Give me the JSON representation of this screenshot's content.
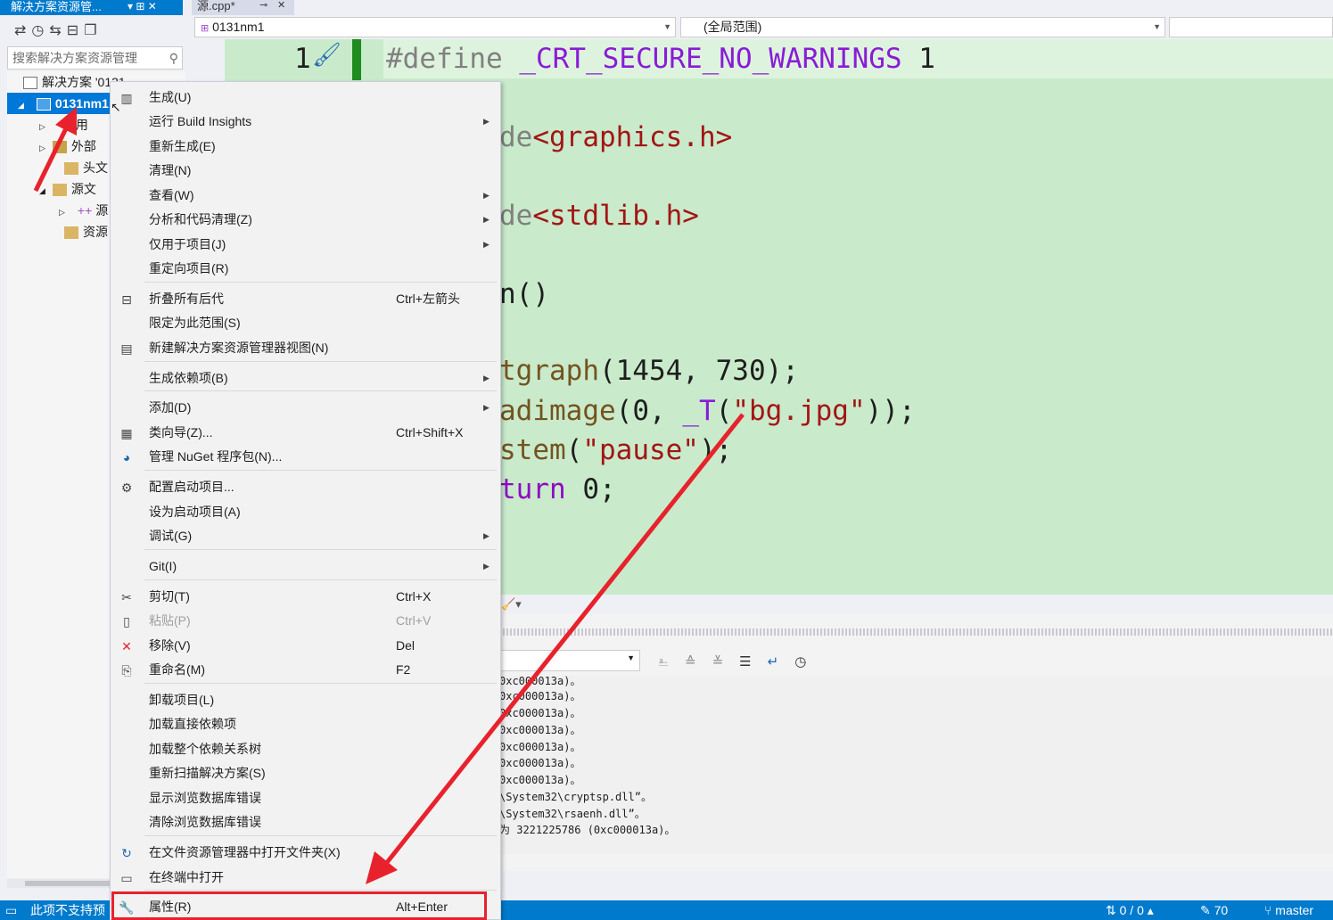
{
  "solution_explorer": {
    "title": "解决方案资源管...",
    "pin": "▾ ⊞ ✕",
    "search_placeholder": "搜索解决方案资源管理",
    "tree": [
      {
        "label": "解决方案 '0131..."
      },
      {
        "label": "0131nm1"
      },
      {
        "label": "引用"
      },
      {
        "label": "外部"
      },
      {
        "label": "头文"
      },
      {
        "label": "源文"
      },
      {
        "label": "源"
      },
      {
        "label": "资源"
      }
    ]
  },
  "editor": {
    "tab_label": "源.cpp*",
    "tab_close": "✕",
    "project_combo": "0131nm1",
    "scope_combo": "(全局范围)",
    "line_number": "1",
    "code": {
      "l1_directive": "#define",
      "l1_macro": "_CRT_SECURE_NO_WARNINGS",
      "l1_value": "1",
      "l2_tail": "de",
      "l2_header": "<graphics.h>",
      "l3_tail": "de",
      "l3_header": "<stdlib.h>",
      "l4": "n()",
      "l5_fn": "tgraph",
      "l5_args": "(1454, 730);",
      "l6_fn": "adimage",
      "l6_a": "(0, ",
      "l6_macro": "_T",
      "l6_b": "(",
      "l6_str": "\"bg.jpg\"",
      "l6_c": "));",
      "l7_fn": "stem",
      "l7_a": "(",
      "l7_str": "\"pause\"",
      "l7_c": ");",
      "l8_kw": "turn",
      "l8_rest": " 0;"
    }
  },
  "output_lines": [
    "0xc000013a)。",
    "0xc000013a)。",
    "0xc000013a)。",
    "0xc000013a)。",
    "0xc000013a)。",
    "0xc000013a)。",
    "0xc000013a)。",
    "\\System32\\cryptsp.dll”。",
    "\\System32\\rsaenh.dll”。",
    "为 3221225786 (0xc000013a)。"
  ],
  "context_menu": {
    "items": [
      {
        "label": "生成(U)",
        "shortcut": "",
        "sub": false,
        "icon": "build-icon",
        "disabled": false
      },
      {
        "label": "运行 Build Insights",
        "shortcut": "",
        "sub": true,
        "icon": "",
        "disabled": false
      },
      {
        "label": "重新生成(E)",
        "shortcut": "",
        "sub": false,
        "icon": "",
        "disabled": false
      },
      {
        "label": "清理(N)",
        "shortcut": "",
        "sub": false,
        "icon": "",
        "disabled": false
      },
      {
        "label": "查看(W)",
        "shortcut": "",
        "sub": true,
        "icon": "",
        "disabled": false
      },
      {
        "label": "分析和代码清理(Z)",
        "shortcut": "",
        "sub": true,
        "icon": "",
        "disabled": false
      },
      {
        "label": "仅用于项目(J)",
        "shortcut": "",
        "sub": true,
        "icon": "",
        "disabled": false
      },
      {
        "label": "重定向项目(R)",
        "shortcut": "",
        "sub": false,
        "icon": "",
        "disabled": false
      },
      {
        "label": "折叠所有后代",
        "shortcut": "Ctrl+左箭头",
        "sub": false,
        "icon": "collapse-icon",
        "disabled": false
      },
      {
        "label": "限定为此范围(S)",
        "shortcut": "",
        "sub": false,
        "icon": "",
        "disabled": false
      },
      {
        "label": "新建解决方案资源管理器视图(N)",
        "shortcut": "",
        "sub": false,
        "icon": "new-view-icon",
        "disabled": false
      },
      {
        "label": "生成依赖项(B)",
        "shortcut": "",
        "sub": true,
        "icon": "",
        "disabled": false
      },
      {
        "label": "添加(D)",
        "shortcut": "",
        "sub": true,
        "icon": "",
        "disabled": false
      },
      {
        "label": "类向导(Z)...",
        "shortcut": "Ctrl+Shift+X",
        "sub": false,
        "icon": "class-wizard-icon",
        "disabled": false
      },
      {
        "label": "管理 NuGet 程序包(N)...",
        "shortcut": "",
        "sub": false,
        "icon": "nuget-icon",
        "disabled": false
      },
      {
        "label": "配置启动项目...",
        "shortcut": "",
        "sub": false,
        "icon": "gear-icon",
        "disabled": false
      },
      {
        "label": "设为启动项目(A)",
        "shortcut": "",
        "sub": false,
        "icon": "",
        "disabled": false
      },
      {
        "label": "调试(G)",
        "shortcut": "",
        "sub": true,
        "icon": "",
        "disabled": false
      },
      {
        "label": "Git(I)",
        "shortcut": "",
        "sub": true,
        "icon": "",
        "disabled": false
      },
      {
        "label": "剪切(T)",
        "shortcut": "Ctrl+X",
        "sub": false,
        "icon": "scissors-icon",
        "disabled": false
      },
      {
        "label": "粘贴(P)",
        "shortcut": "Ctrl+V",
        "sub": false,
        "icon": "paste-icon",
        "disabled": true
      },
      {
        "label": "移除(V)",
        "shortcut": "Del",
        "sub": false,
        "icon": "remove-icon",
        "disabled": false
      },
      {
        "label": "重命名(M)",
        "shortcut": "F2",
        "sub": false,
        "icon": "rename-icon",
        "disabled": false
      },
      {
        "label": "卸载项目(L)",
        "shortcut": "",
        "sub": false,
        "icon": "",
        "disabled": false
      },
      {
        "label": "加载直接依赖项",
        "shortcut": "",
        "sub": false,
        "icon": "",
        "disabled": false
      },
      {
        "label": "加载整个依赖关系树",
        "shortcut": "",
        "sub": false,
        "icon": "",
        "disabled": false
      },
      {
        "label": "重新扫描解决方案(S)",
        "shortcut": "",
        "sub": false,
        "icon": "",
        "disabled": false
      },
      {
        "label": "显示浏览数据库错误",
        "shortcut": "",
        "sub": false,
        "icon": "",
        "disabled": false
      },
      {
        "label": "清除浏览数据库错误",
        "shortcut": "",
        "sub": false,
        "icon": "",
        "disabled": false
      },
      {
        "label": "在文件资源管理器中打开文件夹(X)",
        "shortcut": "",
        "sub": false,
        "icon": "open-folder-icon",
        "disabled": false
      },
      {
        "label": "在终端中打开",
        "shortcut": "",
        "sub": false,
        "icon": "terminal-icon",
        "disabled": false
      },
      {
        "label": "属性(R)",
        "shortcut": "Alt+Enter",
        "sub": false,
        "icon": "wrench-icon",
        "disabled": false
      }
    ]
  },
  "statusbar": {
    "left": "此项不支持预",
    "lines": "0 / 0",
    "edits": "70",
    "branch": "master"
  },
  "colors": {
    "accent": "#007acc",
    "selection": "#0078d7",
    "editor_bg": "#c9ebcb",
    "annotation_red": "#e8222c"
  }
}
